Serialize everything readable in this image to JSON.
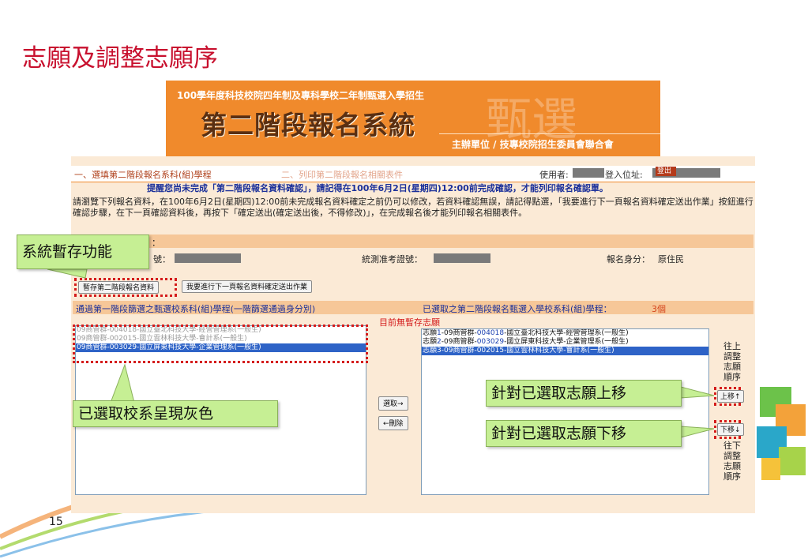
{
  "slide": {
    "title": "志願及調整志願序",
    "page_number": "15"
  },
  "banner": {
    "subtitle": "100學年度科技校院四年制及專科學校二年制甄選入學招生",
    "title": "第二階段報名系統",
    "watermark": "甄選",
    "organizer": "主辦單位 / 技專校院招生委員會聯合會"
  },
  "nav": {
    "step1": "一、選填第二階段報名系科(組)學程",
    "step2": "二、列印第二階段報名相關表件",
    "user_label": "使用者:",
    "ip_label": "登入位址:",
    "logout": "登出"
  },
  "notice": {
    "warning": "提醒您尚未完成「第二階段報名資料確認」，請記得在100年6月2日(星期四)12:00前完成確認，才能列印報名確認單。",
    "info": "請瀏覽下列報名資料，在100年6月2日(星期四)12:00前未完成報名資料確定之前仍可以修改，若資料確認無誤，請記得點選，「我要進行下一頁報名資料確定送出作業」按鈕進行 確認步驟，在下一頁確認資料後，再按下「確定送出(確定送出後，不得修改)」，在完成報名後才能列印報名相關表件。"
  },
  "fields": {
    "section_label": "：",
    "id_label": "號：",
    "exam_label": "統測准考證號：",
    "identity_label": "報名身分：",
    "identity_value": "原住民"
  },
  "buttons": {
    "save_temp": "暫存第二階段報名資料",
    "next_page": "我要進行下一頁報名資料確定送出作業",
    "select": "選取→",
    "delete": "←刪除",
    "move_up": "上移↑",
    "move_down": "下移↓"
  },
  "lists": {
    "left_header": "通過第一階段篩選之甄選校系科(組)學程(一階篩選通過身分別)",
    "right_header": "已選取之第二階段報名甄選入學校系科(組)學程：",
    "right_count": "3個",
    "no_order_msg": "目前無暫存志願",
    "left_items": [
      "09商管群-004018-國立臺北科技大學-經營管理系(一般生)",
      "09商管群-002015-國立雲林科技大學-會計系(一般生)",
      "09商管群-003029-國立屏東科技大學-企業管理系(一般生)"
    ],
    "right_items": [
      {
        "prefix": "志願",
        "num": "1",
        "code": "-09商管群-",
        "dept": "004018",
        "rest": "-國立臺北科技大學-經營管理系(一般生)"
      },
      {
        "prefix": "志願",
        "num": "2",
        "code": "-09商管群-",
        "dept": "003029",
        "rest": "-國立屏東科技大學-企業管理系(一般生)"
      },
      {
        "prefix": "志願",
        "num": "3",
        "code": "-09商管群-",
        "dept": "002015",
        "rest": "-國立雲林科技大學-會計系(一般生)"
      }
    ]
  },
  "side_labels": {
    "up": "往上調整志願順序",
    "down": "往下調整志願順序"
  },
  "callouts": {
    "temp_save": "系統暫存功能",
    "grey_selected": "已選取校系呈現灰色",
    "move_up": "針對已選取志願上移",
    "move_down": "針對已選取志願下移"
  },
  "colors": {
    "accent_red": "#c8102e",
    "banner_orange": "#f08a2c",
    "callout_green": "#c6ef94",
    "selection_blue": "#2e63c7"
  }
}
